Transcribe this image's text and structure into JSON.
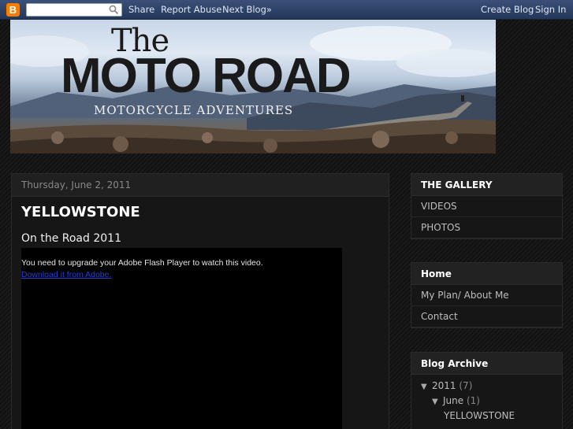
{
  "navbar": {
    "logo_letter": "B",
    "search": {
      "value": "",
      "placeholder": ""
    },
    "links": [
      "Share",
      "Report Abuse",
      "Next Blog»"
    ],
    "right_links": [
      "Create Blog",
      "Sign In"
    ]
  },
  "header": {
    "logo_the": "The",
    "logo_main": "MOTO ROAD",
    "tagline": "MOTORCYCLE ADVENTURES"
  },
  "post": {
    "date": "Thursday, June 2, 2011",
    "title": "YELLOWSTONE",
    "subtitle": "On the Road 2011",
    "flash_message": "You need to upgrade your Adobe Flash Player to watch this video.",
    "flash_link": "Download it from Adobe."
  },
  "sidebar": {
    "gallery": {
      "title": "THE GALLERY",
      "items": [
        "VIDEOS",
        "PHOTOS"
      ]
    },
    "pages": {
      "title": "Home",
      "items": [
        "My Plan/ About Me",
        "Contact"
      ]
    },
    "archive": {
      "title": "Blog Archive",
      "year": "2011",
      "year_count": "(7)",
      "month": "June",
      "month_count": "(1)",
      "post": "YELLOWSTONE"
    }
  },
  "colors": {
    "navbar": "#2c3e5c",
    "blogger_orange": "#f57d00",
    "link_blue": "#1f3fe0"
  },
  "icons": [
    "blogger-logo-icon",
    "search-icon",
    "triangle-down-icon"
  ]
}
